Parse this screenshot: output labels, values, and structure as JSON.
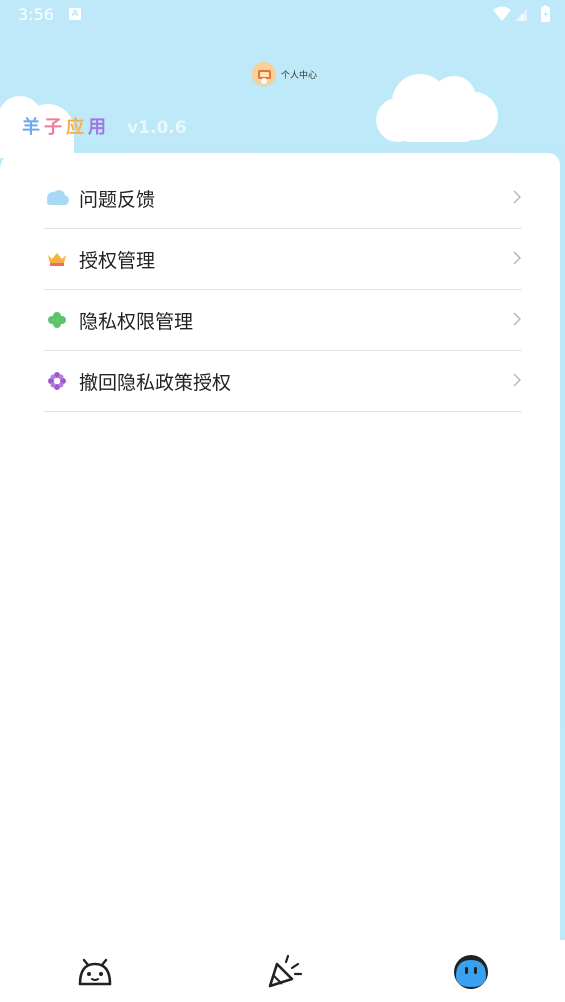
{
  "status_bar": {
    "time": "3:56",
    "notification_badge": "A"
  },
  "header": {
    "title": "个人中心",
    "brand_chars": [
      {
        "char": "羊",
        "color": "#6fa8e8"
      },
      {
        "char": "子",
        "color": "#f07a9a"
      },
      {
        "char": "应",
        "color": "#f7b04a"
      },
      {
        "char": "用",
        "color": "#9b7be0"
      }
    ],
    "version": "v1.0.6"
  },
  "menu": {
    "items": [
      {
        "label": "问题反馈",
        "icon": "cloud-icon"
      },
      {
        "label": "授权管理",
        "icon": "crown-icon"
      },
      {
        "label": "隐私权限管理",
        "icon": "clover-icon"
      },
      {
        "label": "撤回隐私政策授权",
        "icon": "flower-icon"
      }
    ]
  },
  "bottom_nav": {
    "items": [
      {
        "icon": "android-robot-icon",
        "selected": false
      },
      {
        "icon": "party-popper-icon",
        "selected": false
      },
      {
        "icon": "face-icon",
        "selected": true
      }
    ]
  },
  "colors": {
    "sky": "#bfe9f9",
    "accent": "#3aa0f0"
  }
}
